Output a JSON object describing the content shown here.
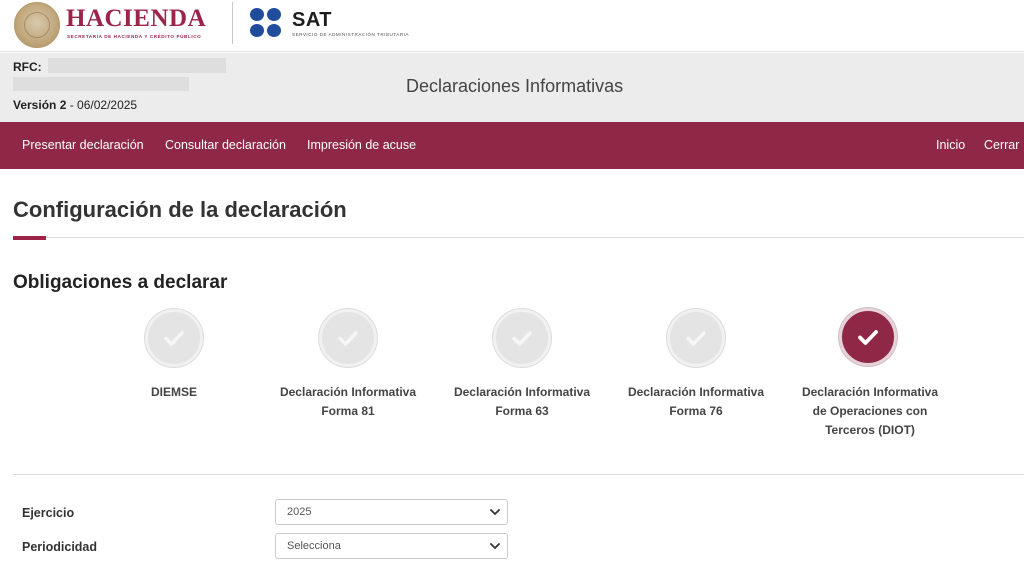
{
  "brand": {
    "hacienda_title": "HACIENDA",
    "hacienda_subtitle": "SECRETARÍA DE HACIENDA Y CRÉDITO PÚBLICO",
    "sat_title": "SAT",
    "sat_subtitle": "SERVICIO DE ADMINISTRACIÓN TRIBUTARIA",
    "primary_color": "#9d2449",
    "sat_color": "#1f4d9c"
  },
  "header": {
    "rfc_label": "RFC:",
    "version_label": "Versión 2",
    "version_date": " - 06/02/2025",
    "title": "Declaraciones Informativas"
  },
  "nav": {
    "bar_color": "#8f2847",
    "left": [
      {
        "label": "Presentar declaración"
      },
      {
        "label": "Consultar declaración"
      },
      {
        "label": "Impresión de acuse"
      }
    ],
    "right": [
      {
        "label": "Inicio"
      },
      {
        "label": "Cerrar"
      }
    ]
  },
  "main": {
    "title": "Configuración de la declaración",
    "obligations_title": "Obligaciones a declarar",
    "obligations": [
      {
        "lines": [
          "DIEMSE"
        ],
        "selected": false,
        "icon": "check-circle-icon"
      },
      {
        "lines": [
          "Declaración Informativa",
          "Forma 81"
        ],
        "selected": false,
        "icon": "check-circle-icon"
      },
      {
        "lines": [
          "Declaración Informativa",
          "Forma 63"
        ],
        "selected": false,
        "icon": "check-circle-icon"
      },
      {
        "lines": [
          "Declaración Informativa",
          "Forma 76"
        ],
        "selected": false,
        "icon": "check-circle-icon"
      },
      {
        "lines": [
          "Declaración Informativa",
          "de Operaciones con",
          "Terceros (DIOT)"
        ],
        "selected": true,
        "icon": "check-circle-icon"
      }
    ]
  },
  "form": {
    "ejercicio": {
      "label": "Ejercicio",
      "value": "2025"
    },
    "periodicidad": {
      "label": "Periodicidad",
      "value": "Selecciona"
    }
  }
}
